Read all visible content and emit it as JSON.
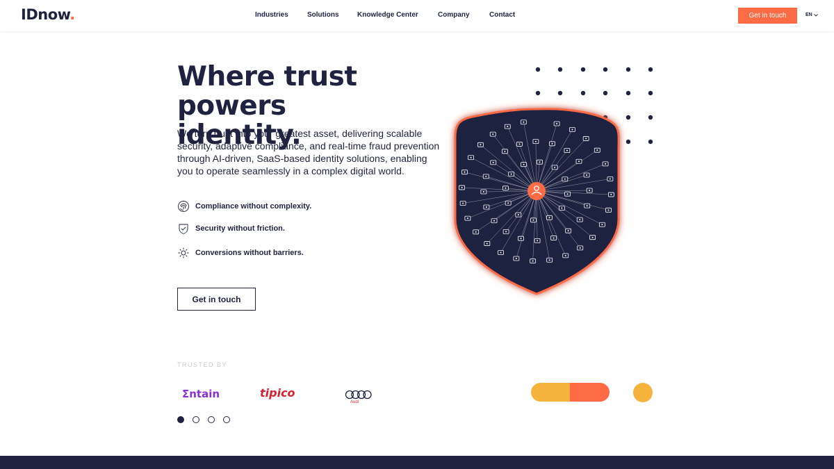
{
  "header": {
    "logo_text": "IDnow",
    "logo_dot": ".",
    "nav": [
      {
        "label": "Industries"
      },
      {
        "label": "Solutions"
      },
      {
        "label": "Knowledge Center"
      },
      {
        "label": "Company"
      },
      {
        "label": "Contact"
      }
    ],
    "cta_label": "Get in touch",
    "language": "EN"
  },
  "hero": {
    "title_line1": "Where trust powers",
    "title_line2": "identity.",
    "description": "We turn trust into your greatest asset, delivering scalable security, adaptive compliance, and real-time fraud prevention through AI-driven, SaaS-based identity solutions, enabling you to operate seamlessly in a complex digital world.",
    "features": [
      {
        "icon": "fingerprint-icon",
        "label": "Compliance without complexity."
      },
      {
        "icon": "shield-check-icon",
        "label": "Security without friction."
      },
      {
        "icon": "gear-icon",
        "label": "Conversions without barriers."
      }
    ],
    "cta_label": "Get in touch"
  },
  "trusted": {
    "heading": "TRUSTED BY",
    "brands": [
      {
        "name": "Entain",
        "text": "Σntain"
      },
      {
        "name": "Tipico",
        "text": "tipico"
      },
      {
        "name": "Audi",
        "text": "Audi"
      }
    ],
    "carousel_pages": 4,
    "active_page": 1
  },
  "colors": {
    "navy": "#1f2240",
    "accent": "#ff6b45",
    "yellow": "#f5b33e"
  }
}
